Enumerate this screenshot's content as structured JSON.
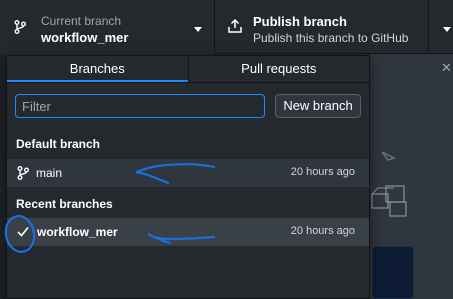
{
  "toolbar": {
    "branch": {
      "label": "Current branch",
      "value": "workflow_mer",
      "icon": "git-branch-icon"
    },
    "publish": {
      "title": "Publish branch",
      "subtitle": "Publish this branch to GitHub",
      "icon": "upload-icon"
    }
  },
  "dropdown": {
    "tabs": [
      {
        "label": "Branches",
        "active": true
      },
      {
        "label": "Pull requests",
        "active": false
      }
    ],
    "filter": {
      "placeholder": "Filter",
      "value": ""
    },
    "new_branch_label": "New branch",
    "sections": {
      "default": {
        "title": "Default branch",
        "items": [
          {
            "name": "main",
            "time": "20 hours ago",
            "icon": "git-branch-icon"
          }
        ]
      },
      "recent": {
        "title": "Recent branches",
        "items": [
          {
            "name": "workflow_mer",
            "time": "20 hours ago",
            "icon": "check-icon",
            "selected": true
          }
        ]
      }
    }
  },
  "colors": {
    "accent": "#2188ff",
    "background": "#24292e",
    "annotation": "#1a6fe0"
  }
}
